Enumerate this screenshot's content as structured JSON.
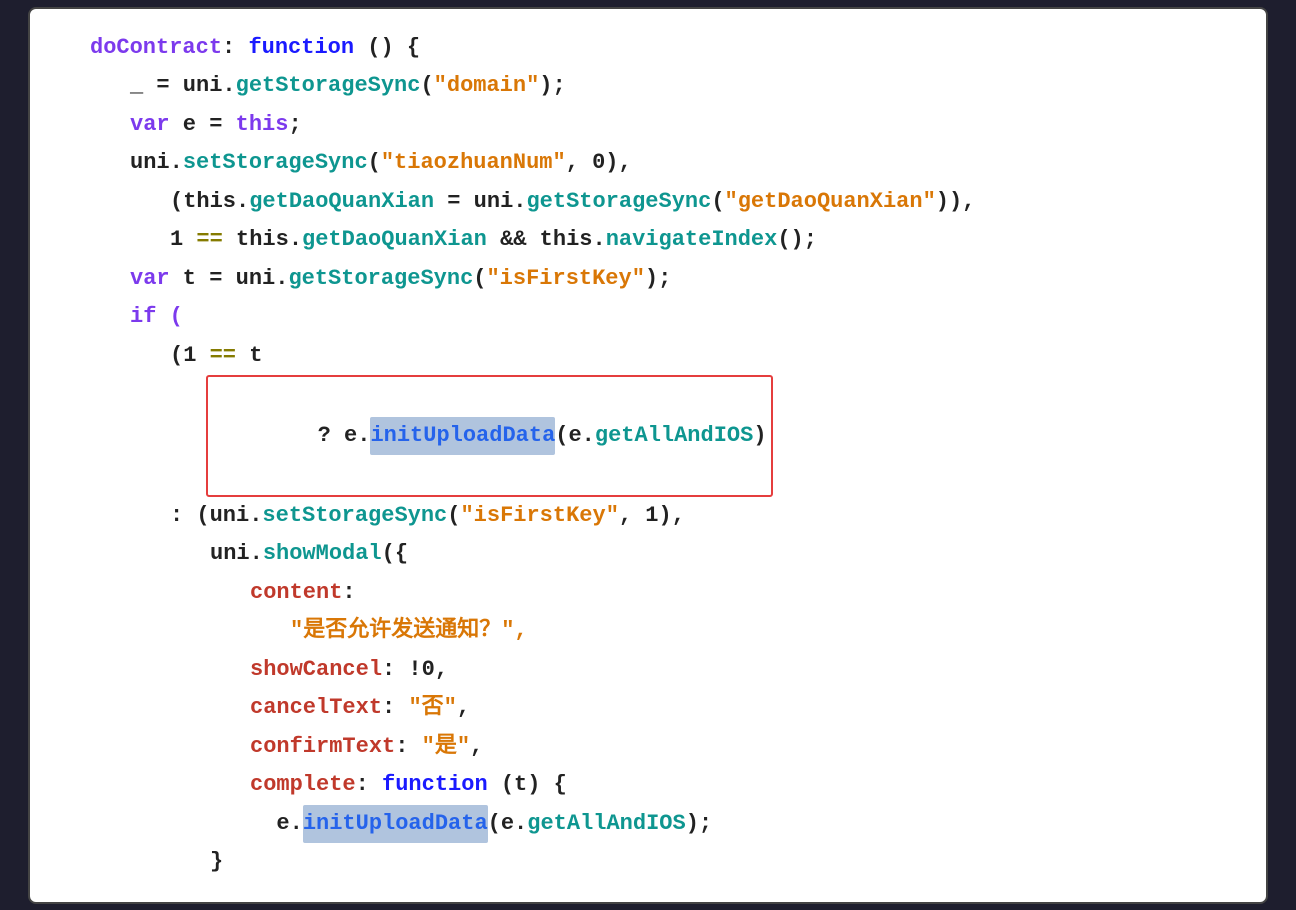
{
  "editor": {
    "background": "#ffffff",
    "lines": [
      {
        "id": "line1",
        "indentClass": "indent-1",
        "parts": [
          {
            "text": "doContract",
            "color": "c-purple"
          },
          {
            "text": ": ",
            "color": "c-black"
          },
          {
            "text": "function",
            "color": "c-darkblue"
          },
          {
            "text": " () {",
            "color": "c-black"
          }
        ]
      },
      {
        "id": "line2",
        "indentClass": "indent-2",
        "parts": [
          {
            "text": "_ = uni.",
            "color": "c-black"
          },
          {
            "text": "getStorageSync",
            "color": "c-teal"
          },
          {
            "text": "(",
            "color": "c-black"
          },
          {
            "text": "\"domain\"",
            "color": "c-orange"
          },
          {
            "text": ");",
            "color": "c-black"
          }
        ]
      },
      {
        "id": "line3",
        "indentClass": "indent-2",
        "parts": [
          {
            "text": "var",
            "color": "c-purple"
          },
          {
            "text": " e = ",
            "color": "c-black"
          },
          {
            "text": "this",
            "color": "c-purple"
          },
          {
            "text": ";",
            "color": "c-black"
          }
        ]
      },
      {
        "id": "line4",
        "indentClass": "indent-2",
        "parts": [
          {
            "text": "uni.",
            "color": "c-black"
          },
          {
            "text": "setStorageSync",
            "color": "c-teal"
          },
          {
            "text": "(",
            "color": "c-black"
          },
          {
            "text": "\"tiaozhuanNum\"",
            "color": "c-orange"
          },
          {
            "text": ", 0),",
            "color": "c-black"
          }
        ]
      },
      {
        "id": "line5",
        "indentClass": "indent-3",
        "parts": [
          {
            "text": "(this.",
            "color": "c-black"
          },
          {
            "text": "getDaoQuanXian",
            "color": "c-teal"
          },
          {
            "text": " = uni.",
            "color": "c-black"
          },
          {
            "text": "getStorageSync",
            "color": "c-teal"
          },
          {
            "text": "(",
            "color": "c-black"
          },
          {
            "text": "\"getDaoQuanXian\"",
            "color": "c-orange"
          },
          {
            "text": ")),",
            "color": "c-black"
          }
        ]
      },
      {
        "id": "line6",
        "indentClass": "indent-3",
        "parts": [
          {
            "text": "1 ",
            "color": "c-black"
          },
          {
            "text": "==",
            "color": "c-olive"
          },
          {
            "text": " this.",
            "color": "c-black"
          },
          {
            "text": "getDaoQuanXian",
            "color": "c-teal"
          },
          {
            "text": " && this.",
            "color": "c-black"
          },
          {
            "text": "navigateIndex",
            "color": "c-teal"
          },
          {
            "text": "();",
            "color": "c-black"
          }
        ]
      },
      {
        "id": "line7",
        "indentClass": "indent-2",
        "parts": [
          {
            "text": "var",
            "color": "c-purple"
          },
          {
            "text": " t = uni.",
            "color": "c-black"
          },
          {
            "text": "getStorageSync",
            "color": "c-teal"
          },
          {
            "text": "(",
            "color": "c-black"
          },
          {
            "text": "\"isFirstKey\"",
            "color": "c-orange"
          },
          {
            "text": ");",
            "color": "c-black"
          }
        ]
      },
      {
        "id": "line8",
        "indentClass": "indent-2",
        "parts": [
          {
            "text": "if (",
            "color": "c-purple"
          }
        ]
      },
      {
        "id": "line9",
        "indentClass": "indent-3",
        "parts": [
          {
            "text": "(1 ",
            "color": "c-black"
          },
          {
            "text": "==",
            "color": "c-olive"
          },
          {
            "text": " t",
            "color": "c-black"
          }
        ]
      },
      {
        "id": "line10",
        "indentClass": "indent-4",
        "highlighted": true,
        "redBorder": true,
        "parts": [
          {
            "text": "? e.",
            "color": "c-black"
          },
          {
            "text": "initUploadData",
            "color": "c-blue",
            "highlight": true
          },
          {
            "text": "(e.",
            "color": "c-black"
          },
          {
            "text": "getAllAndIOS",
            "color": "c-teal"
          },
          {
            "text": ")",
            "color": "c-black"
          }
        ]
      },
      {
        "id": "line11",
        "indentClass": "indent-3",
        "parts": [
          {
            "text": ": (uni.",
            "color": "c-black"
          },
          {
            "text": "setStorageSync",
            "color": "c-teal"
          },
          {
            "text": "(",
            "color": "c-black"
          },
          {
            "text": "\"isFirstKey\"",
            "color": "c-orange"
          },
          {
            "text": ", 1),",
            "color": "c-black"
          }
        ]
      },
      {
        "id": "line12",
        "indentClass": "indent-4",
        "parts": [
          {
            "text": "uni.",
            "color": "c-black"
          },
          {
            "text": "showModal",
            "color": "c-teal"
          },
          {
            "text": "({",
            "color": "c-black"
          }
        ]
      },
      {
        "id": "line13",
        "indentClass": "indent-5",
        "parts": [
          {
            "text": "content",
            "color": "c-red-key"
          },
          {
            "text": ":",
            "color": "c-black"
          }
        ]
      },
      {
        "id": "line14",
        "indentClass": "indent-5",
        "extraIndent": true,
        "parts": [
          {
            "text": "  \"是否允许发送通知？\",",
            "color": "c-orange"
          }
        ]
      },
      {
        "id": "line15",
        "indentClass": "indent-5",
        "parts": [
          {
            "text": "showCancel",
            "color": "c-red-key"
          },
          {
            "text": ": !0,",
            "color": "c-black"
          }
        ]
      },
      {
        "id": "line16",
        "indentClass": "indent-5",
        "parts": [
          {
            "text": "cancelText",
            "color": "c-red-key"
          },
          {
            "text": ": ",
            "color": "c-black"
          },
          {
            "text": "\"否\"",
            "color": "c-orange"
          },
          {
            "text": ",",
            "color": "c-black"
          }
        ]
      },
      {
        "id": "line17",
        "indentClass": "indent-5",
        "parts": [
          {
            "text": "confirmText",
            "color": "c-red-key"
          },
          {
            "text": ": ",
            "color": "c-black"
          },
          {
            "text": "\"是\"",
            "color": "c-orange"
          },
          {
            "text": ",",
            "color": "c-black"
          }
        ]
      },
      {
        "id": "line18",
        "indentClass": "indent-5",
        "parts": [
          {
            "text": "complete",
            "color": "c-red-key"
          },
          {
            "text": ": ",
            "color": "c-black"
          },
          {
            "text": "function",
            "color": "c-darkblue"
          },
          {
            "text": " (t) {",
            "color": "c-black"
          }
        ]
      },
      {
        "id": "line19",
        "indentClass": "indent-5",
        "parts": [
          {
            "text": "  e.",
            "color": "c-black"
          },
          {
            "text": "initUploadData",
            "color": "c-blue",
            "highlight": true
          },
          {
            "text": "(e.",
            "color": "c-black"
          },
          {
            "text": "getAllAndIOS",
            "color": "c-teal"
          },
          {
            "text": ");",
            "color": "c-black"
          }
        ]
      },
      {
        "id": "line20",
        "indentClass": "indent-4",
        "parts": [
          {
            "text": "}",
            "color": "c-black"
          }
        ]
      }
    ]
  }
}
